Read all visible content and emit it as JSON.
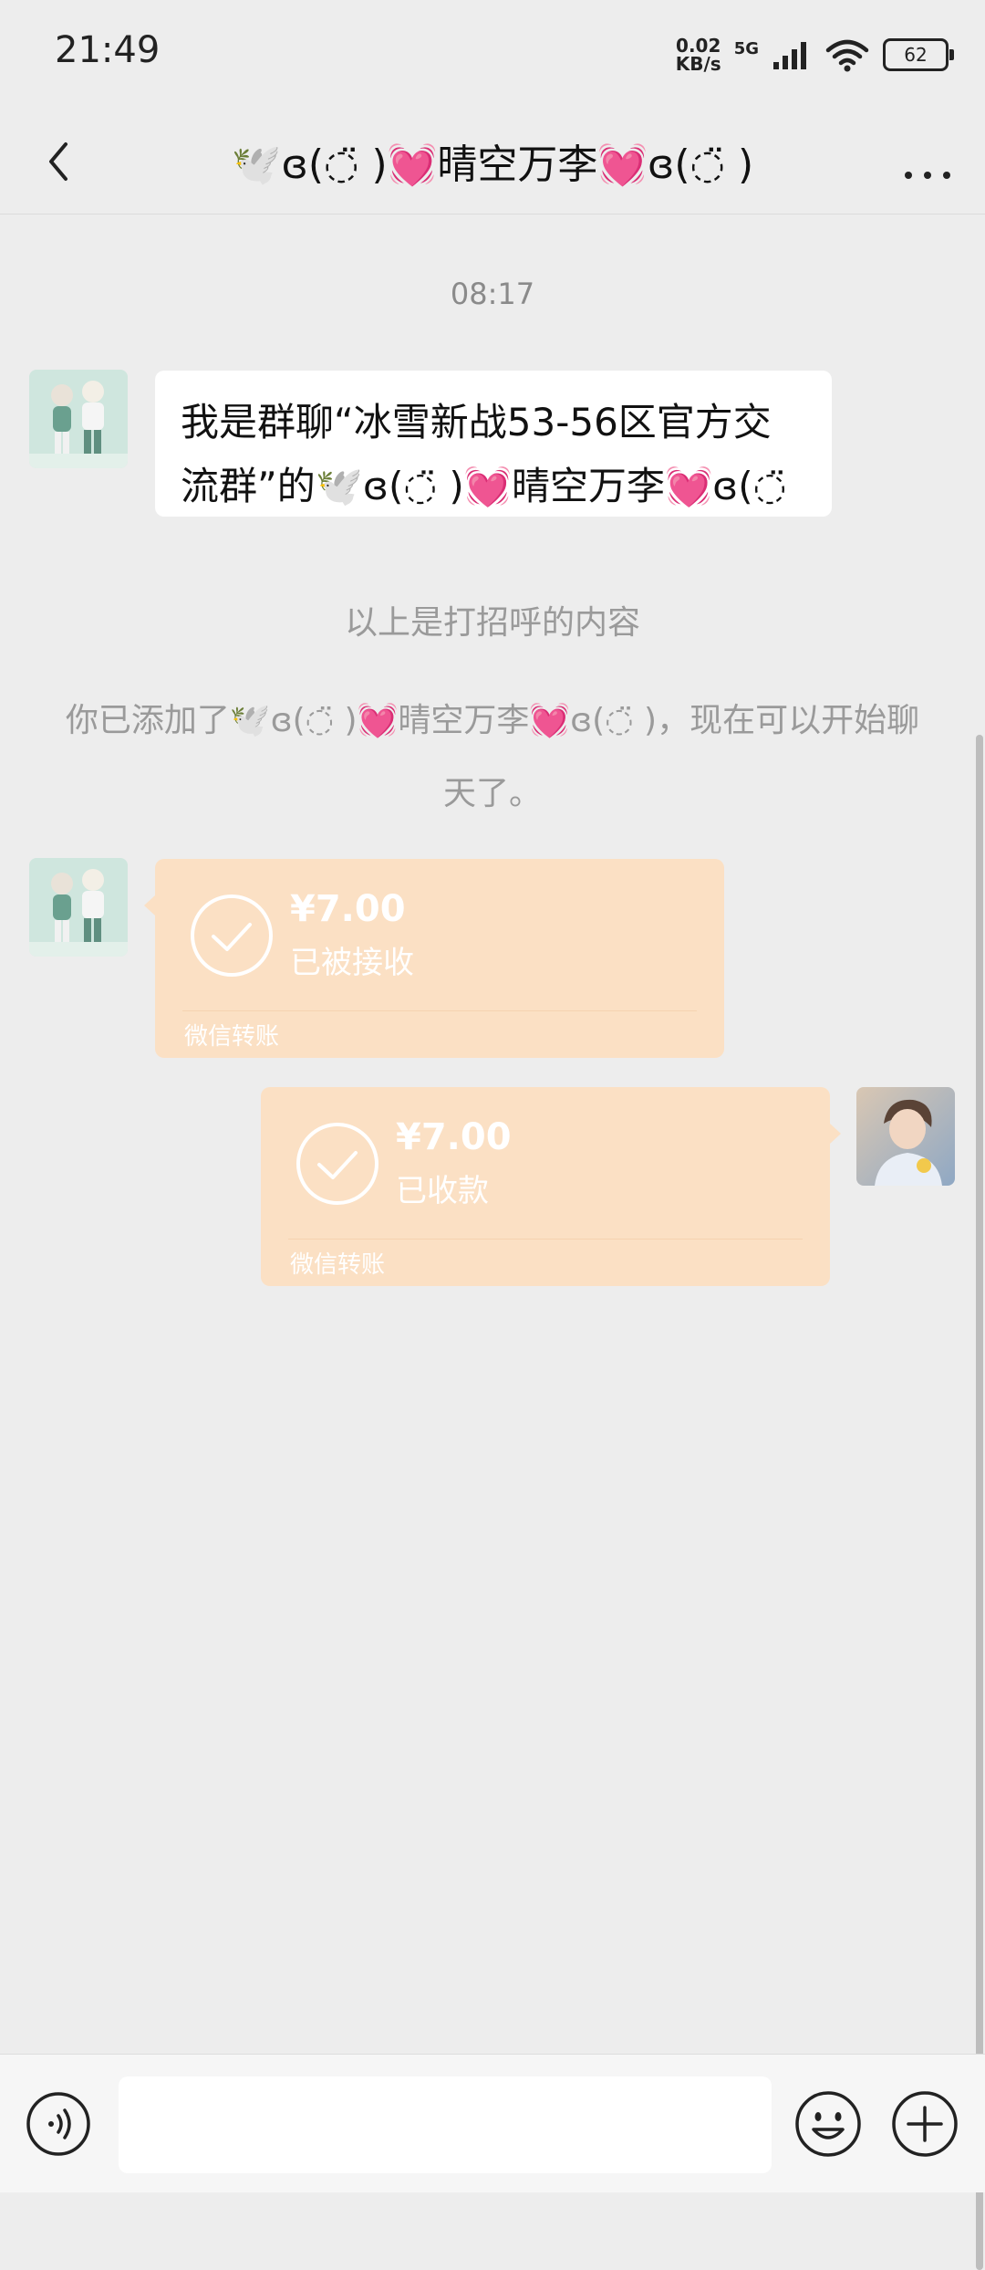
{
  "status_bar": {
    "time": "21:49",
    "net_speed_value": "0.02",
    "net_speed_unit": "KB/s",
    "network": "5G",
    "battery": "62"
  },
  "header": {
    "title": "🕊️ɞ(◌̈ )💓晴空万李💓ɞ(◌̈ )",
    "back_icon": "chevron-left-icon",
    "more_icon": "more-dots-icon"
  },
  "chat": {
    "timestamp": "08:17",
    "greeting_message": "我是群聊“冰雪新战53-56区官方交流群”的🕊️ɞ(◌̈ )💓晴空万李💓ɞ(◌̈ ",
    "system_note_1": "以上是打招呼的内容",
    "system_note_2": "你已添加了🕊️ɞ(◌̈ )💓晴空万李💓ɞ(◌̈ )，现在可以开始聊天了。",
    "transfers": [
      {
        "amount": "¥7.00",
        "status": "已被接收",
        "footer": "微信转账"
      },
      {
        "amount": "¥7.00",
        "status": "已收款",
        "footer": "微信转账"
      }
    ],
    "colors": {
      "transfer_bg": "#fbe0c4",
      "chat_bg": "#ededed"
    }
  },
  "input_bar": {
    "voice_icon": "voice-icon",
    "emoji_icon": "emoji-icon",
    "plus_icon": "plus-circle-icon"
  }
}
